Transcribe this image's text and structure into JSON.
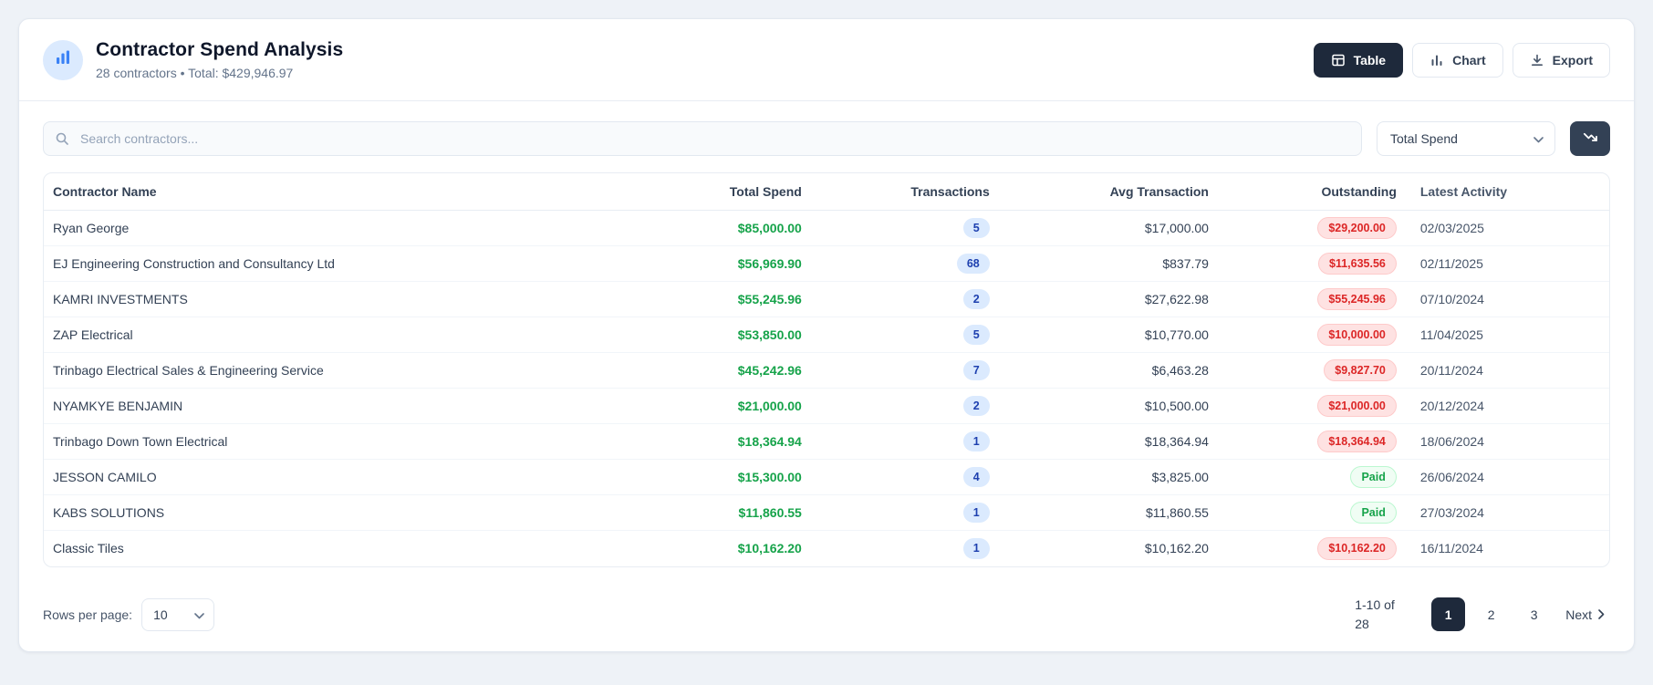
{
  "header": {
    "title": "Contractor Spend Analysis",
    "subtitle": "28 contractors • Total: $429,946.97",
    "view_buttons": [
      {
        "label": "Table",
        "active": true
      },
      {
        "label": "Chart",
        "active": false
      },
      {
        "label": "Export",
        "active": false
      }
    ]
  },
  "controls": {
    "search_placeholder": "Search contractors...",
    "sort_field_value": "Total Spend"
  },
  "table": {
    "columns": [
      "Contractor Name",
      "Total Spend",
      "Transactions",
      "Avg Transaction",
      "Outstanding",
      "Latest Activity"
    ],
    "rows": [
      {
        "name": "Ryan George",
        "total": "$85,000.00",
        "transactions": "5",
        "avg": "$17,000.00",
        "outstanding": "$29,200.00",
        "status": "due",
        "latest": "02/03/2025"
      },
      {
        "name": "EJ Engineering Construction and Consultancy Ltd",
        "total": "$56,969.90",
        "transactions": "68",
        "avg": "$837.79",
        "outstanding": "$11,635.56",
        "status": "due",
        "latest": "02/11/2025"
      },
      {
        "name": "KAMRI INVESTMENTS",
        "total": "$55,245.96",
        "transactions": "2",
        "avg": "$27,622.98",
        "outstanding": "$55,245.96",
        "status": "due",
        "latest": "07/10/2024"
      },
      {
        "name": "ZAP Electrical",
        "total": "$53,850.00",
        "transactions": "5",
        "avg": "$10,770.00",
        "outstanding": "$10,000.00",
        "status": "due",
        "latest": "11/04/2025"
      },
      {
        "name": "Trinbago Electrical Sales & Engineering Service",
        "total": "$45,242.96",
        "transactions": "7",
        "avg": "$6,463.28",
        "outstanding": "$9,827.70",
        "status": "due",
        "latest": "20/11/2024"
      },
      {
        "name": "NYAMKYE BENJAMIN",
        "total": "$21,000.00",
        "transactions": "2",
        "avg": "$10,500.00",
        "outstanding": "$21,000.00",
        "status": "due",
        "latest": "20/12/2024"
      },
      {
        "name": "Trinbago Down Town Electrical",
        "total": "$18,364.94",
        "transactions": "1",
        "avg": "$18,364.94",
        "outstanding": "$18,364.94",
        "status": "due",
        "latest": "18/06/2024"
      },
      {
        "name": "JESSON CAMILO",
        "total": "$15,300.00",
        "transactions": "4",
        "avg": "$3,825.00",
        "outstanding": "Paid",
        "status": "paid",
        "latest": "26/06/2024"
      },
      {
        "name": "KABS SOLUTIONS",
        "total": "$11,860.55",
        "transactions": "1",
        "avg": "$11,860.55",
        "outstanding": "Paid",
        "status": "paid",
        "latest": "27/03/2024"
      },
      {
        "name": "Classic Tiles",
        "total": "$10,162.20",
        "transactions": "1",
        "avg": "$10,162.20",
        "outstanding": "$10,162.20",
        "status": "due",
        "latest": "16/11/2024"
      }
    ]
  },
  "footer": {
    "rows_per_page_label": "Rows per page:",
    "rows_per_page_value": "10",
    "range_text": "1-10 of 28",
    "pages": [
      "1",
      "2",
      "3"
    ],
    "active_page": "1",
    "next_label": "Next"
  },
  "colors": {
    "accent_dark": "#1e293b",
    "money_green": "#16a34a",
    "transaction_badge_bg": "#dbeafe",
    "transaction_badge_text": "#1e40af",
    "outstanding_badge_bg": "#fee2e2",
    "outstanding_badge_text": "#dc2626",
    "paid_badge_bg": "#f0fdf4",
    "paid_badge_text": "#16a34a",
    "header_icon_bg": "#dbeafe",
    "header_icon_color": "#3b82f6"
  }
}
